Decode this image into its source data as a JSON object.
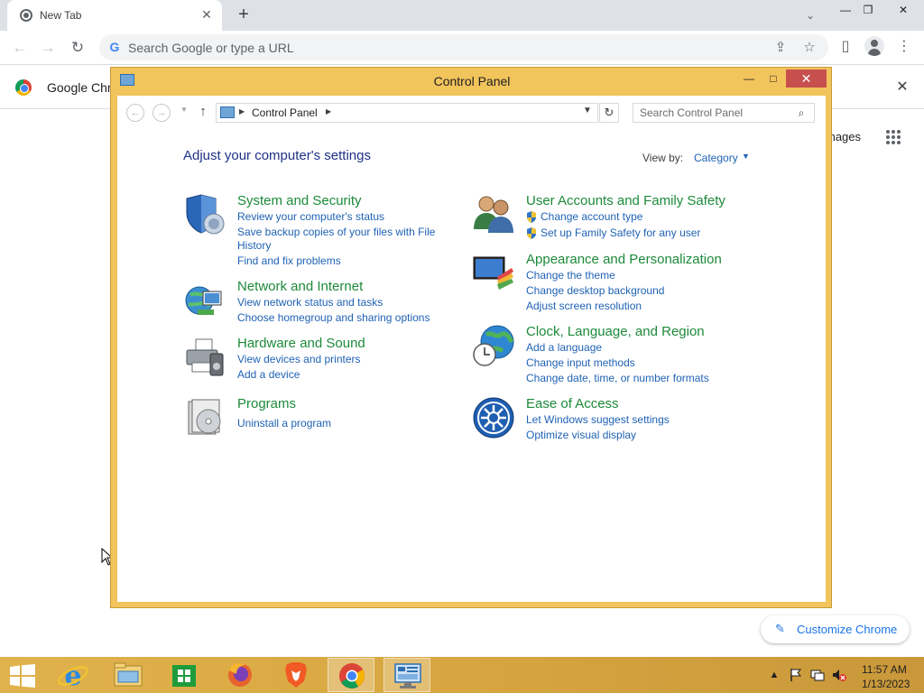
{
  "browser": {
    "tab_title": "New Tab",
    "tab_close": "✕",
    "new_tab": "+",
    "omnibox_placeholder": "Search Google or type a URL",
    "infobar_text": "Google Chro",
    "images_link": "mages",
    "customize_label": "Customize Chrome"
  },
  "control_panel": {
    "title": "Control Panel",
    "breadcrumb": "Control Panel",
    "search_placeholder": "Search Control Panel",
    "heading": "Adjust your computer's settings",
    "view_by_label": "View by:",
    "view_by_value": "Category",
    "categories": [
      {
        "title": "System and Security",
        "icon": "shield-icon",
        "links": [
          "Review your computer's status",
          "Save backup copies of your files with File",
          "History",
          "Find and fix problems"
        ]
      },
      {
        "title": "Network and Internet",
        "icon": "network-globe-icon",
        "links": [
          "View network status and tasks",
          "Choose homegroup and sharing options"
        ]
      },
      {
        "title": "Hardware and Sound",
        "icon": "printer-icon",
        "links": [
          "View devices and printers",
          "Add a device"
        ]
      },
      {
        "title": "Programs",
        "icon": "programs-disc-icon",
        "links": [
          "Uninstall a program"
        ]
      },
      {
        "title": "User Accounts and Family Safety",
        "icon": "users-icon",
        "links": [
          "Change account type",
          "Set up Family Safety for any user"
        ]
      },
      {
        "title": "Appearance and Personalization",
        "icon": "monitor-palette-icon",
        "links": [
          "Change the theme",
          "Change desktop background",
          "Adjust screen resolution"
        ]
      },
      {
        "title": "Clock, Language, and Region",
        "icon": "globe-clock-icon",
        "links": [
          "Add a language",
          "Change input methods",
          "Change date, time, or number formats"
        ]
      },
      {
        "title": "Ease of Access",
        "icon": "ease-of-access-icon",
        "links": [
          "Let Windows suggest settings",
          "Optimize visual display"
        ]
      }
    ]
  },
  "taskbar": {
    "apps": [
      "internet-explorer-icon",
      "file-explorer-icon",
      "store-icon",
      "firefox-icon",
      "brave-icon",
      "chrome-icon",
      "control-panel-icon"
    ],
    "time": "11:57 AM",
    "date": "1/13/2023"
  },
  "colors": {
    "window_frame": "#f2c45c",
    "category_title": "#1d8a3a",
    "link": "#1f62b4",
    "heading": "#1e3287",
    "close_button": "#c7504f"
  }
}
